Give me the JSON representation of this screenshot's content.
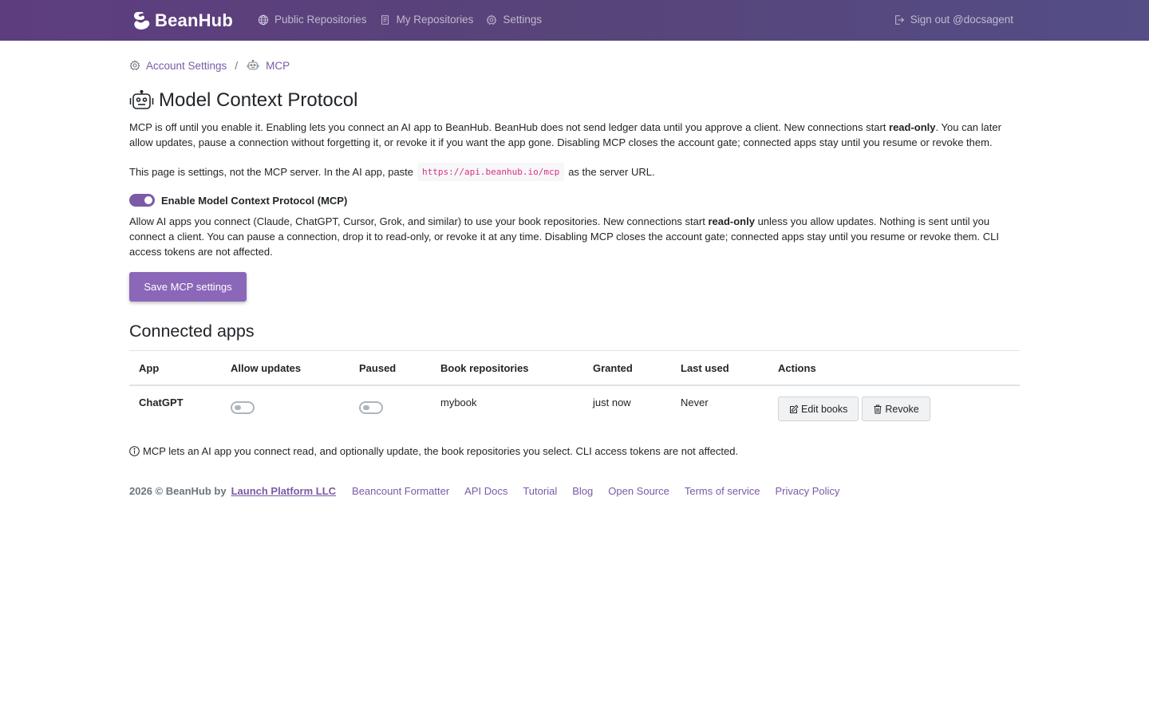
{
  "nav": {
    "brand": "BeanHub",
    "links": [
      {
        "label": "Public Repositories",
        "icon": "globe-icon"
      },
      {
        "label": "My Repositories",
        "icon": "book-icon"
      },
      {
        "label": "Settings",
        "icon": "gear-icon"
      }
    ],
    "signout": "Sign out @docsagent"
  },
  "breadcrumb": {
    "items": [
      {
        "label": "Account Settings",
        "icon": "gear-icon"
      },
      {
        "label": "MCP",
        "icon": "robot-icon"
      }
    ],
    "separator": "/"
  },
  "page": {
    "title": "Model Context Protocol",
    "intro_part1": "MCP is off until you enable it. Enabling lets you connect an AI app to BeanHub. BeanHub does not send ledger data until you approve a client. New connections start ",
    "intro_bold": "read-only",
    "intro_part2": ". You can later allow updates, pause a connection without forgetting it, or revoke it if you want the app gone. Disabling MCP closes the account gate; connected apps stay until you resume or revoke them.",
    "server_note_before": "This page is settings, not the MCP server. In the AI app, paste",
    "server_url": "https://api.beanhub.io/mcp",
    "server_note_after": "as the server URL."
  },
  "mcp_toggle": {
    "label": "Enable Model Context Protocol (MCP)",
    "enabled": true,
    "help_part1": "Allow AI apps you connect (Claude, ChatGPT, Cursor, Grok, and similar) to use your book repositories. New connections start ",
    "help_bold": "read-only",
    "help_part2": " unless you allow updates. Nothing is sent until you connect a client. You can pause a connection, drop it to read-only, or revoke it at any time. Disabling MCP closes the account gate; connected apps stay until you resume or revoke them. CLI access tokens are not affected."
  },
  "save_button": "Save MCP settings",
  "connected": {
    "heading": "Connected apps",
    "columns": [
      "App",
      "Allow updates",
      "Paused",
      "Book repositories",
      "Granted",
      "Last used",
      "Actions"
    ],
    "rows": [
      {
        "app": "ChatGPT",
        "allow_updates": false,
        "paused": false,
        "books": "mybook",
        "granted": "just now",
        "last_used": "Never",
        "edit_label": "Edit books",
        "revoke_label": "Revoke"
      }
    ]
  },
  "info_note": "MCP lets an AI app you connect read, and optionally update, the book repositories you select. CLI access tokens are not affected.",
  "footer": {
    "copyright": "2026 © BeanHub by",
    "company": "Launch Platform LLC",
    "links": [
      "Beancount Formatter",
      "API Docs",
      "Tutorial",
      "Blog",
      "Open Source",
      "Terms of service",
      "Privacy Policy"
    ]
  },
  "colors": {
    "nav_gradient_start": "#5e3d7f",
    "nav_gradient_end": "#544d86",
    "accent": "#7b5aa6",
    "button": "#8a67b8",
    "code": "#d63384"
  }
}
